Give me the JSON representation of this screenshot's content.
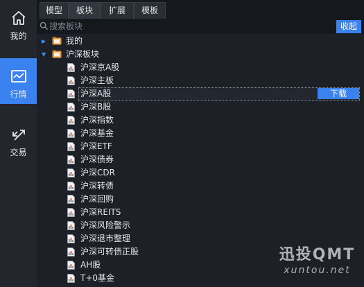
{
  "sidebar": {
    "items": [
      {
        "label": "我的",
        "icon": "home-icon"
      },
      {
        "label": "行情",
        "icon": "chart-line-icon"
      },
      {
        "label": "交易",
        "icon": "trade-arrows-icon"
      }
    ],
    "active_index": 1
  },
  "tabs": [
    {
      "label": "模型"
    },
    {
      "label": "板块"
    },
    {
      "label": "扩展"
    },
    {
      "label": "模板"
    }
  ],
  "search": {
    "placeholder": "搜索板块",
    "icon": "search-icon"
  },
  "collapse_label": "收起",
  "tree": {
    "groups": [
      {
        "label": "我的",
        "expanded": false,
        "icon": "folder-icon"
      },
      {
        "label": "沪深板块",
        "expanded": true,
        "icon": "folder-icon"
      }
    ],
    "items": [
      {
        "label": "沪深京A股"
      },
      {
        "label": "沪深主板"
      },
      {
        "label": "沪深A股"
      },
      {
        "label": "沪深B股"
      },
      {
        "label": "沪深指数"
      },
      {
        "label": "沪深基金"
      },
      {
        "label": "沪深ETF"
      },
      {
        "label": "沪深债券"
      },
      {
        "label": "沪深CDR"
      },
      {
        "label": "沪深转债"
      },
      {
        "label": "沪深回购"
      },
      {
        "label": "沪深REITS"
      },
      {
        "label": "沪深风险警示"
      },
      {
        "label": "沪深退市整理"
      },
      {
        "label": "沪深可转债正股"
      },
      {
        "label": "AH股"
      },
      {
        "label": "T+0基金"
      }
    ],
    "selected_index": 2,
    "download_label": "下载"
  },
  "watermark": {
    "line1": "迅投QMT",
    "line2": "xuntou.net"
  },
  "colors": {
    "accent": "#3a82f0",
    "sidebar_bg": "#23262c",
    "main_bg": "#1d2026"
  }
}
